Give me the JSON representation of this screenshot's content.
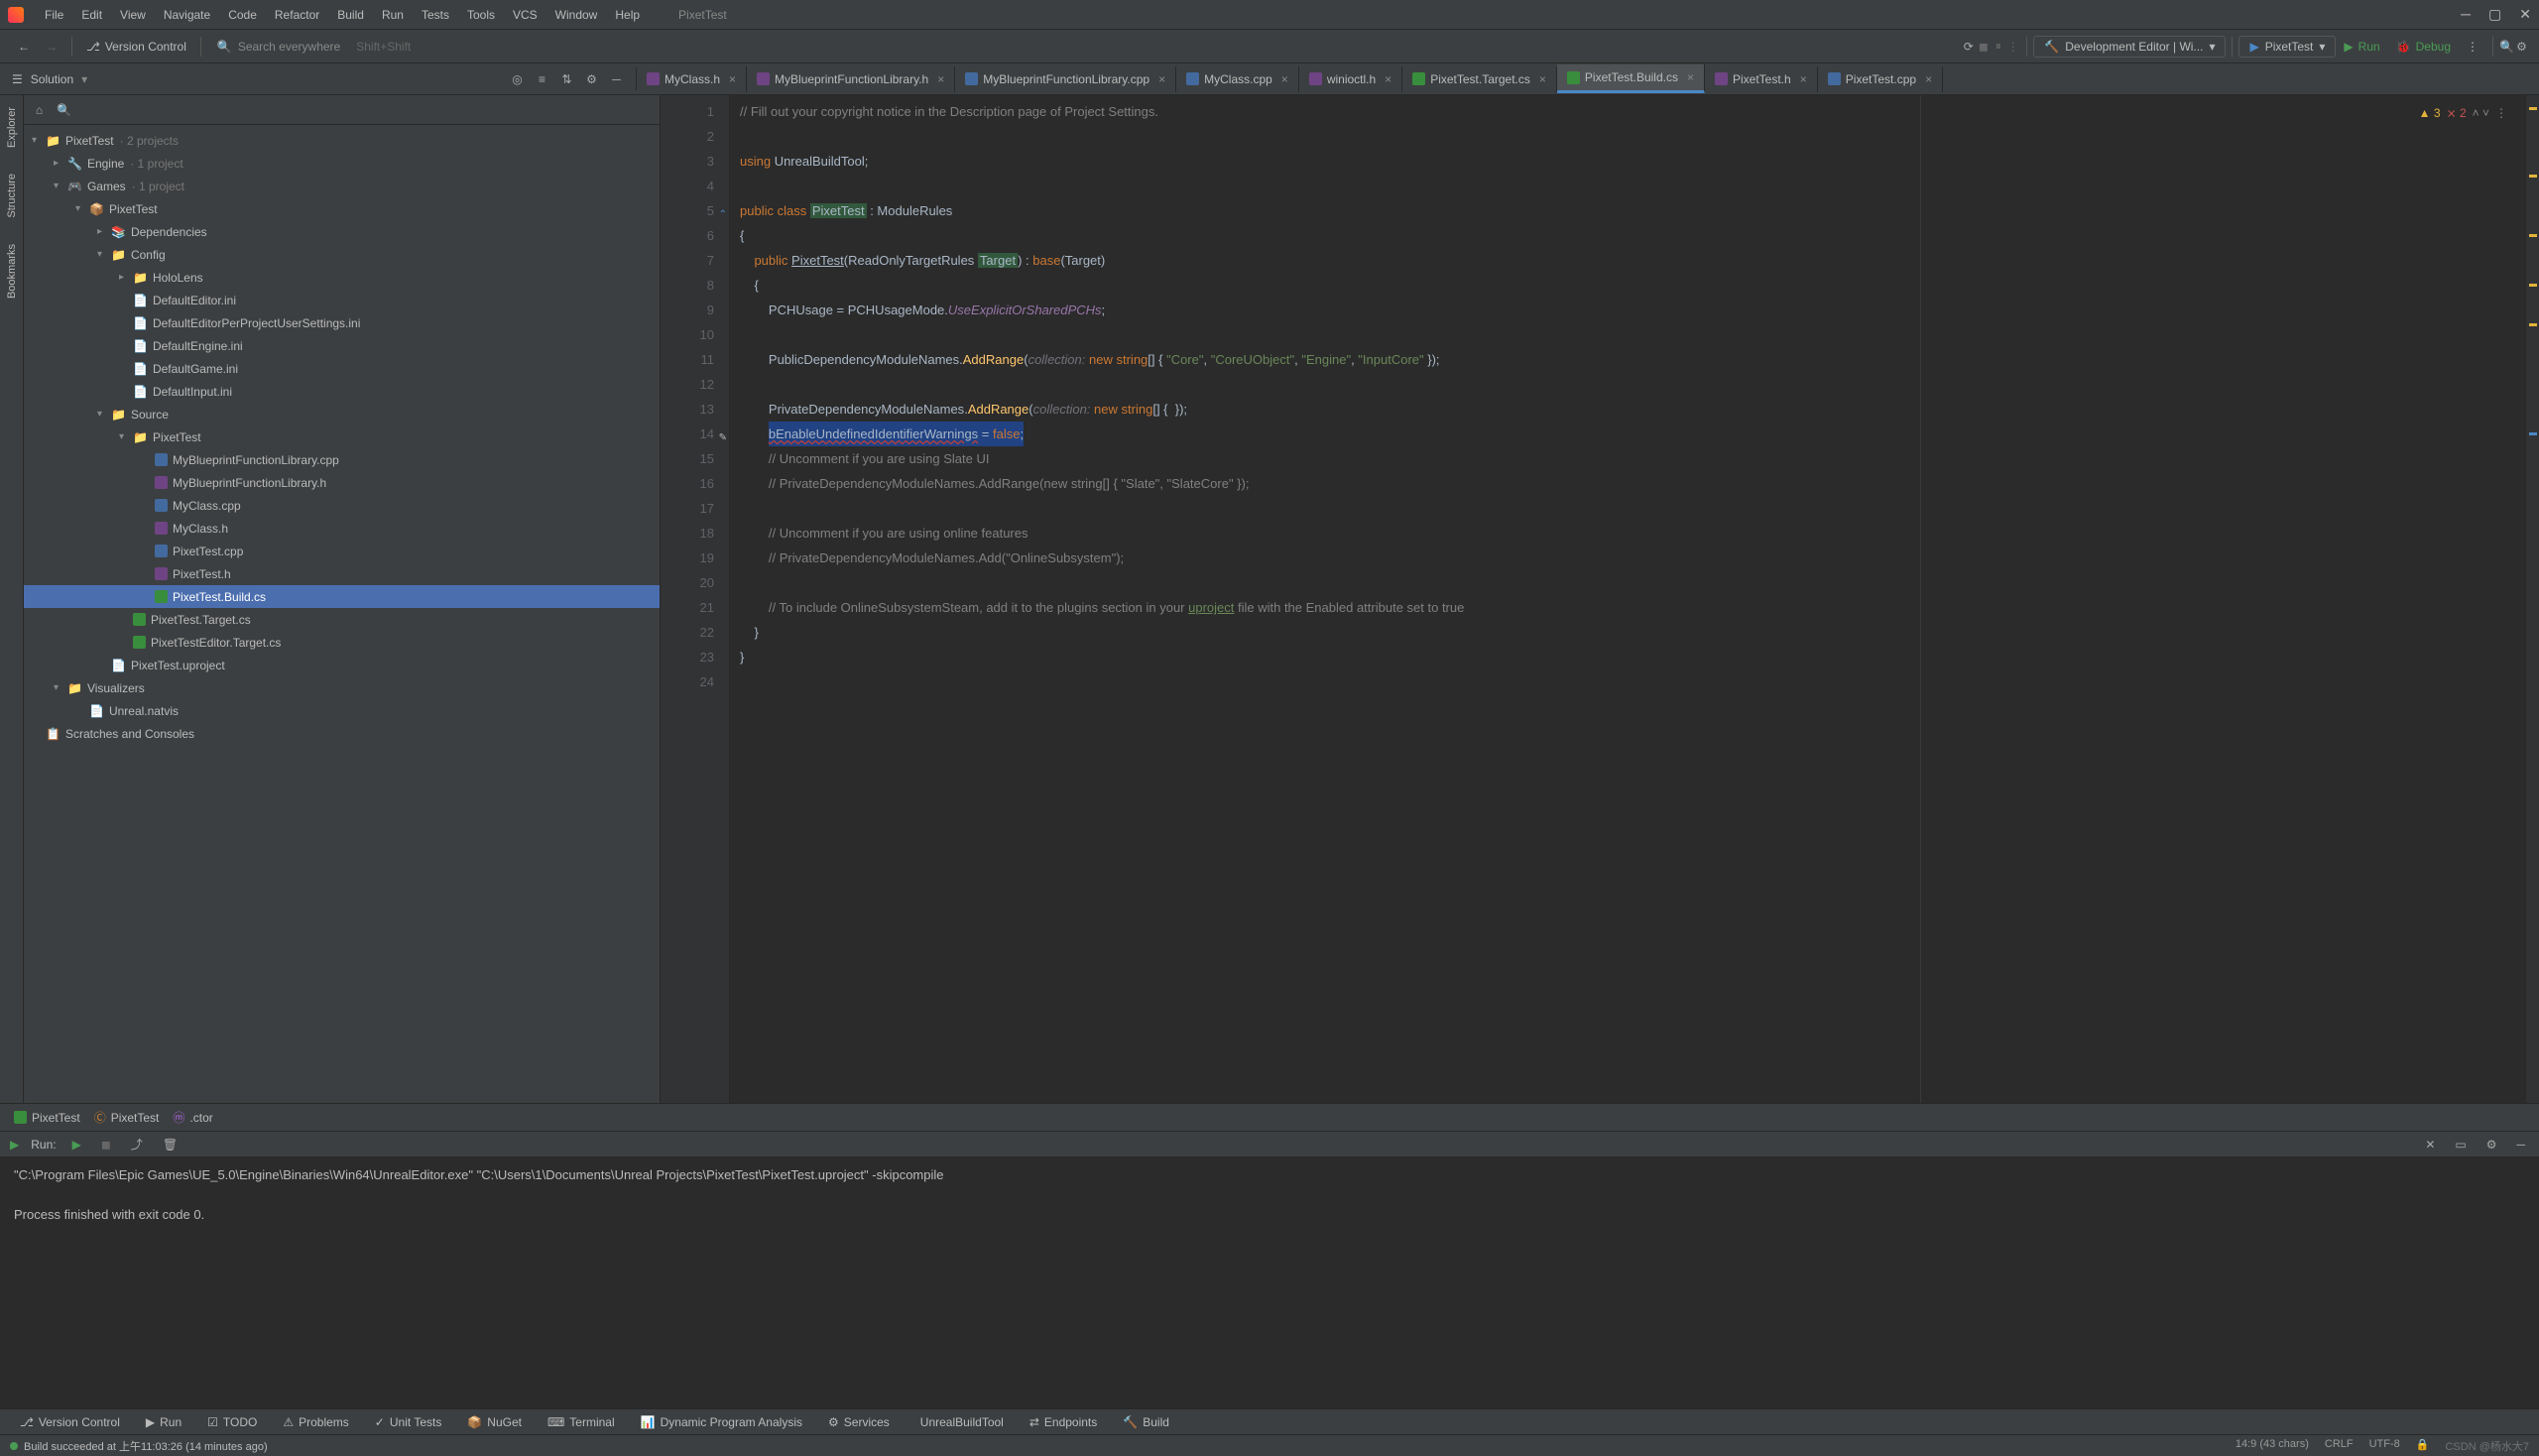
{
  "menu": [
    "File",
    "Edit",
    "View",
    "Navigate",
    "Code",
    "Refactor",
    "Build",
    "Run",
    "Tests",
    "Tools",
    "VCS",
    "Window",
    "Help"
  ],
  "title": "PixetTest",
  "toolbar": {
    "version_control": "Version Control",
    "search_placeholder": "Search everywhere",
    "search_hint": "Shift+Shift",
    "config": "Development Editor | Wi...",
    "run_target": "PixetTest",
    "run_label": "Run",
    "debug_label": "Debug"
  },
  "solution_label": "Solution",
  "tabs": [
    {
      "icon": "h",
      "label": "MyClass.h"
    },
    {
      "icon": "h",
      "label": "MyBlueprintFunctionLibrary.h"
    },
    {
      "icon": "cpp",
      "label": "MyBlueprintFunctionLibrary.cpp"
    },
    {
      "icon": "cpp",
      "label": "MyClass.cpp"
    },
    {
      "icon": "h",
      "label": "winioctl.h"
    },
    {
      "icon": "cs",
      "label": "PixetTest.Target.cs"
    },
    {
      "icon": "cs",
      "label": "PixetTest.Build.cs",
      "active": true
    },
    {
      "icon": "h",
      "label": "PixetTest.h"
    },
    {
      "icon": "cpp",
      "label": "PixetTest.cpp"
    }
  ],
  "side_tabs": [
    "Explorer",
    "Structure",
    "Bookmarks"
  ],
  "tree": [
    {
      "d": 0,
      "a": "▾",
      "i": "📁",
      "t": "PixetTest",
      "dim": "· 2 projects"
    },
    {
      "d": 1,
      "a": "▸",
      "i": "🔧",
      "t": "Engine",
      "dim": "· 1 project"
    },
    {
      "d": 1,
      "a": "▾",
      "i": "🎮",
      "t": "Games",
      "dim": "· 1 project"
    },
    {
      "d": 2,
      "a": "▾",
      "i": "📦",
      "t": "PixetTest"
    },
    {
      "d": 3,
      "a": "▸",
      "i": "📚",
      "t": "Dependencies"
    },
    {
      "d": 3,
      "a": "▾",
      "i": "📁",
      "t": "Config"
    },
    {
      "d": 4,
      "a": "▸",
      "i": "📁",
      "t": "HoloLens"
    },
    {
      "d": 4,
      "a": "",
      "i": "📄",
      "t": "DefaultEditor.ini"
    },
    {
      "d": 4,
      "a": "",
      "i": "📄",
      "t": "DefaultEditorPerProjectUserSettings.ini"
    },
    {
      "d": 4,
      "a": "",
      "i": "📄",
      "t": "DefaultEngine.ini"
    },
    {
      "d": 4,
      "a": "",
      "i": "📄",
      "t": "DefaultGame.ini"
    },
    {
      "d": 4,
      "a": "",
      "i": "📄",
      "t": "DefaultInput.ini"
    },
    {
      "d": 3,
      "a": "▾",
      "i": "📁",
      "t": "Source"
    },
    {
      "d": 4,
      "a": "▾",
      "i": "📁",
      "t": "PixetTest"
    },
    {
      "d": 5,
      "a": "",
      "i": "cpp",
      "t": "MyBlueprintFunctionLibrary.cpp"
    },
    {
      "d": 5,
      "a": "",
      "i": "h",
      "t": "MyBlueprintFunctionLibrary.h"
    },
    {
      "d": 5,
      "a": "",
      "i": "cpp",
      "t": "MyClass.cpp"
    },
    {
      "d": 5,
      "a": "",
      "i": "h",
      "t": "MyClass.h"
    },
    {
      "d": 5,
      "a": "",
      "i": "cpp",
      "t": "PixetTest.cpp"
    },
    {
      "d": 5,
      "a": "",
      "i": "h",
      "t": "PixetTest.h"
    },
    {
      "d": 5,
      "a": "",
      "i": "cs",
      "t": "PixetTest.Build.cs",
      "sel": true
    },
    {
      "d": 4,
      "a": "",
      "i": "cs",
      "t": "PixetTest.Target.cs"
    },
    {
      "d": 4,
      "a": "",
      "i": "cs",
      "t": "PixetTestEditor.Target.cs"
    },
    {
      "d": 3,
      "a": "",
      "i": "📄",
      "t": "PixetTest.uproject"
    },
    {
      "d": 1,
      "a": "▾",
      "i": "📁",
      "t": "Visualizers"
    },
    {
      "d": 2,
      "a": "",
      "i": "📄",
      "t": "Unreal.natvis"
    },
    {
      "d": 0,
      "a": "",
      "i": "📋",
      "t": "Scratches and Consoles"
    }
  ],
  "code_lines": 24,
  "warnings": {
    "w": "3",
    "e": "2"
  },
  "breadcrumbs": [
    {
      "i": "cs",
      "t": "PixetTest"
    },
    {
      "i": "cls",
      "t": "PixetTest"
    },
    {
      "i": "m",
      "t": ".ctor"
    }
  ],
  "run": {
    "title": "Run:",
    "cmd": "\"C:\\Program Files\\Epic Games\\UE_5.0\\Engine\\Binaries\\Win64\\UnrealEditor.exe\" \"C:\\Users\\1\\Documents\\Unreal Projects\\PixetTest\\PixetTest.uproject\" -skipcompile",
    "out": "Process finished with exit code 0."
  },
  "bottom_tabs": [
    "Version Control",
    "Run",
    "TODO",
    "Problems",
    "Unit Tests",
    "NuGet",
    "Terminal",
    "Dynamic Program Analysis",
    "Services",
    "UnrealBuildTool",
    "Endpoints",
    "Build"
  ],
  "status": {
    "msg": "Build succeeded at 上午11:03:26 (14 minutes ago)",
    "pos": "14:9 (43 chars)",
    "eol": "CRLF",
    "enc": "UTF-8",
    "branch": "🔒",
    "watermark": "CSDN @杨水大7"
  }
}
